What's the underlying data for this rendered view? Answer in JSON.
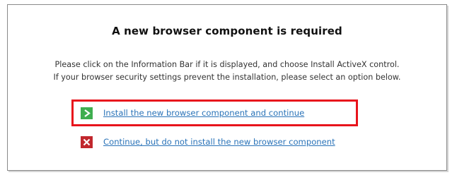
{
  "dialog": {
    "title": "A new browser component is required",
    "message_line1": "Please click on the Information Bar if it is displayed, and choose Install ActiveX control.",
    "message_line2": "If your browser security settings prevent the installation, please select an option below."
  },
  "options": [
    {
      "label": "Install the new browser component and continue",
      "icon": "green-arrow-icon",
      "highlighted": true
    },
    {
      "label": "Continue, but do not install the new browser component",
      "icon": "red-x-icon",
      "highlighted": false
    }
  ],
  "colors": {
    "link": "#2a73b8",
    "highlight_border": "#e8141c",
    "go_icon": "#3fae4f",
    "stop_icon": "#c1272d"
  }
}
